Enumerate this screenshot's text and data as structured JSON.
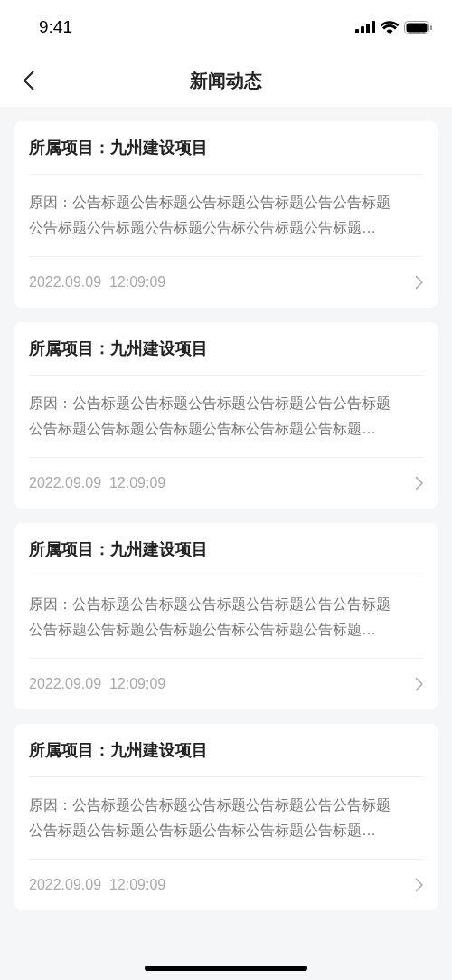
{
  "status_bar": {
    "time": "9:41"
  },
  "nav": {
    "title": "新闻动态"
  },
  "news": [
    {
      "project": "所属项目：九州建设项目",
      "reason_lines": [
        "原因：公告标题公告标题公告标题公告标题公告公告标题",
        "公告标题公告标题公告标题公告标公告标题公告标题…"
      ],
      "datetime": "2022.09.09  12:09:09"
    },
    {
      "project": "所属项目：九州建设项目",
      "reason_lines": [
        "原因：公告标题公告标题公告标题公告标题公告公告标题",
        "公告标题公告标题公告标题公告标公告标题公告标题…"
      ],
      "datetime": "2022.09.09  12:09:09"
    },
    {
      "project": "所属项目：九州建设项目",
      "reason_lines": [
        "原因：公告标题公告标题公告标题公告标题公告公告标题",
        "公告标题公告标题公告标题公告标公告标题公告标题…"
      ],
      "datetime": "2022.09.09  12:09:09"
    },
    {
      "project": "所属项目：九州建设项目",
      "reason_lines": [
        "原因：公告标题公告标题公告标题公告标题公告公告标题",
        "公告标题公告标题公告标题公告标公告标题公告标题…"
      ],
      "datetime": "2022.09.09  12:09:09"
    }
  ]
}
